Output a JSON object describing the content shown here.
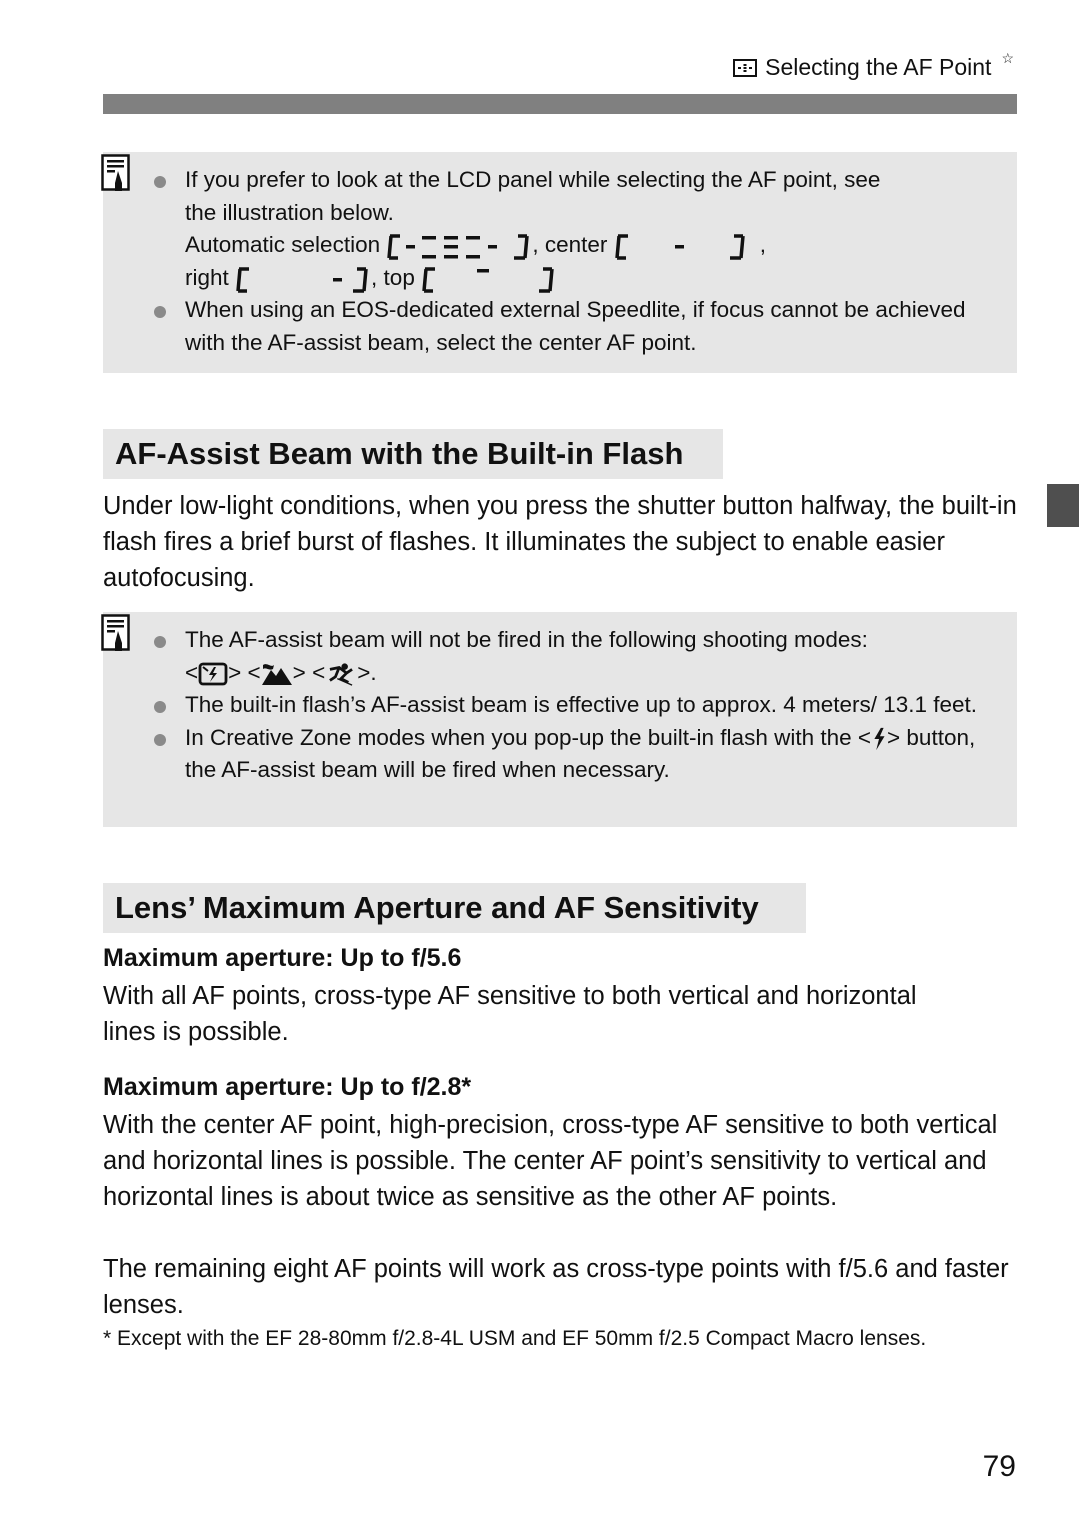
{
  "header": {
    "icon": "af-point-selection-icon",
    "title": "Selecting the AF Point",
    "marker": "☆"
  },
  "note1": {
    "icon": "note-pencil-icon",
    "bullet1_line1": "If you prefer to look at the LCD panel while selecting the AF point, see",
    "bullet1_line2": "the illustration below.",
    "auto_label": "Automatic selection",
    "center_label": ", center",
    "trailing_comma": ",",
    "right_label": "right",
    "top_label": ", top",
    "lcd_icons": [
      "lcd-automatic-selection-icon",
      "lcd-center-icon",
      "lcd-right-icon",
      "lcd-top-icon"
    ],
    "bullet2": "When using an EOS-dedicated external Speedlite, if focus cannot be achieved with the AF-assist beam, select the center AF point."
  },
  "section1": {
    "title": "AF-Assist Beam with the Built-in Flash",
    "body": "Under low-light conditions, when you press the shutter button halfway, the built-in flash fires a brief burst of flashes. It illuminates the subject to enable easier autofocusing."
  },
  "note2": {
    "icon": "note-pencil-icon",
    "bullet1": "The AF-assist beam will not be fired in the following shooting modes:",
    "modes_prefix": "<",
    "modes_sep": "> <",
    "modes_suffix": ">.",
    "mode_icons": [
      "flash-off-mode-icon",
      "landscape-mode-icon",
      "sports-mode-icon"
    ],
    "bullet2": "The built-in flash’s AF-assist beam is effective up to approx. 4 meters/ 13.1 feet.",
    "bullet3_pre": "In Creative Zone modes when you pop-up the built-in flash with the <",
    "bullet3_icon": "flash-button-icon",
    "bullet3_post": "> button, the AF-assist beam will be fired when necessary."
  },
  "section2": {
    "title": "Lens’ Maximum Aperture and AF Sensitivity",
    "sub1": "Maximum aperture: Up to f/5.6",
    "body1": "With all AF points, cross-type AF sensitive to both vertical and horizontal lines is possible.",
    "sub2": "Maximum aperture: Up to f/2.8*",
    "body2": "With the center AF point, high-precision, cross-type AF sensitive to both vertical and horizontal lines is possible. The center AF point’s sensitivity to vertical and horizontal lines is about twice as sensitive as the other AF points.",
    "body3": "The remaining eight AF points will work as cross-type points with f/5.6 and faster lenses.",
    "footnote": "* Except with the EF 28-80mm f/2.8-4L USM and EF 50mm f/2.5 Compact Macro lenses."
  },
  "page": {
    "number": "79"
  }
}
